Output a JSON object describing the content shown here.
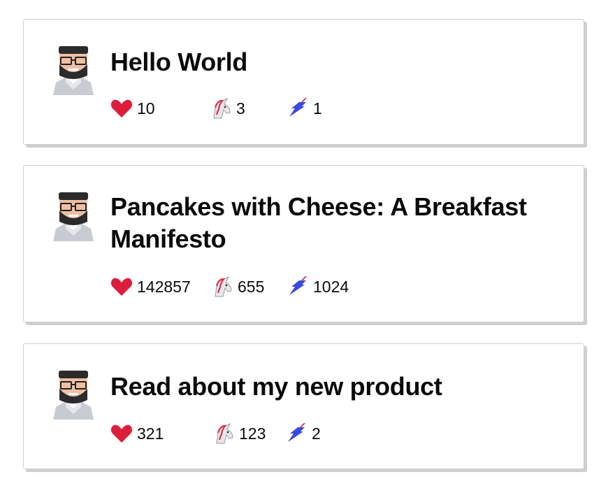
{
  "posts": [
    {
      "title": "Hello World",
      "hearts": "10",
      "unicorns": "3",
      "bookmarks": "1"
    },
    {
      "title": "Pancakes with Cheese: A Breakfast Manifesto",
      "hearts": "142857",
      "unicorns": "655",
      "bookmarks": "1024"
    },
    {
      "title": "Read about my new product",
      "hearts": "321",
      "unicorns": "123",
      "bookmarks": "2"
    }
  ],
  "icons": {
    "avatar": "bearded-man-avatar-icon",
    "heart": "heart-icon",
    "unicorn": "unicorn-icon",
    "bookmark": "bookmark-icon"
  },
  "colors": {
    "heart": "#dc1e3c",
    "bookmark": "#3b49df",
    "card_border": "#cfcfcf"
  }
}
